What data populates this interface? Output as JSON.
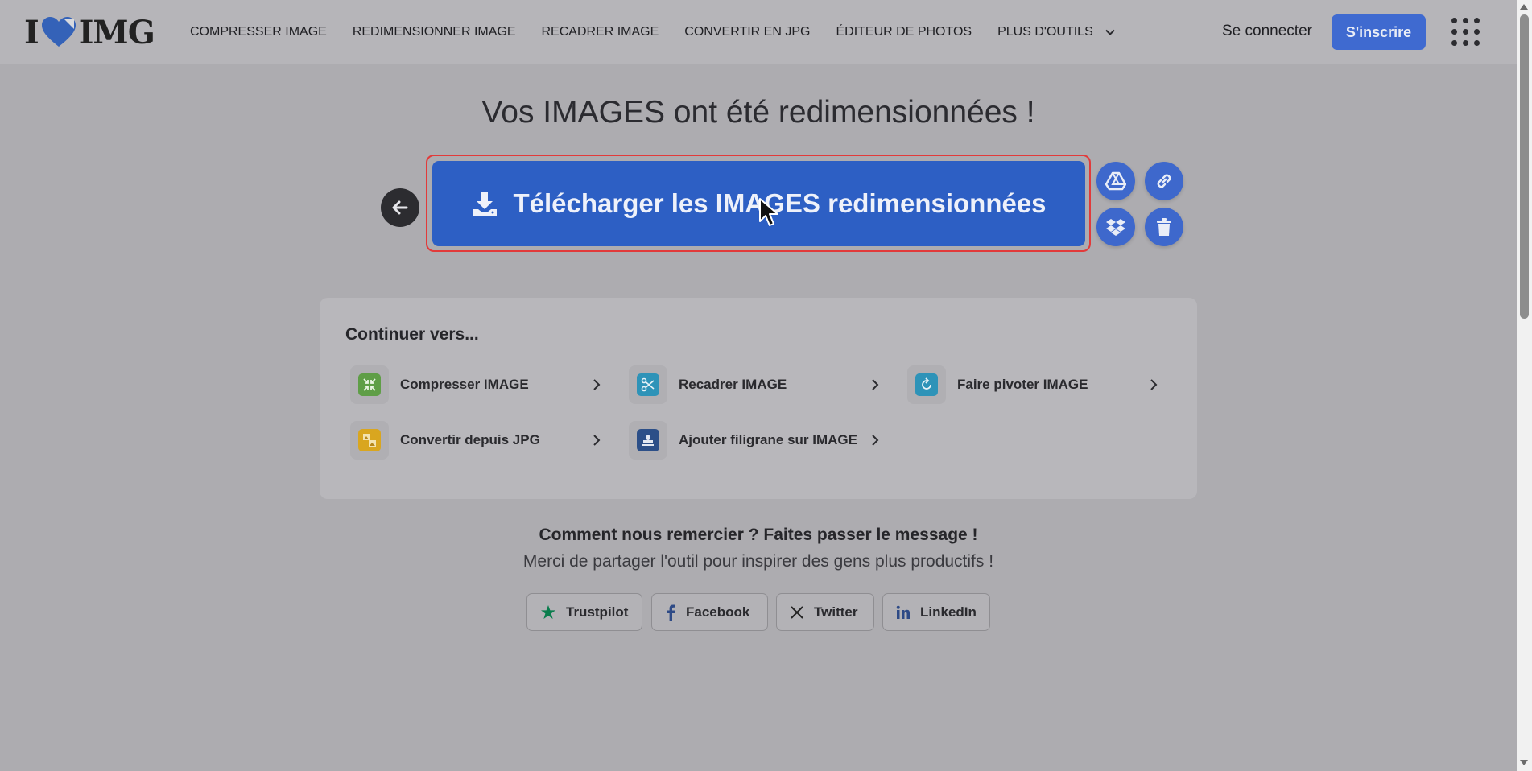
{
  "header": {
    "logo_text": "IMG",
    "logo_prefix": "I",
    "nav": [
      {
        "label": "COMPRESSER IMAGE"
      },
      {
        "label": "REDIMENSIONNER IMAGE"
      },
      {
        "label": "RECADRER IMAGE"
      },
      {
        "label": "CONVERTIR EN JPG"
      },
      {
        "label": "ÉDITEUR DE PHOTOS"
      },
      {
        "label": "PLUS D'OUTILS"
      }
    ],
    "login_label": "Se connecter",
    "signup_label": "S'inscrire"
  },
  "main": {
    "title": "Vos IMAGES ont été redimensionnées !",
    "download_label": "Télécharger les IMAGES redimensionnées"
  },
  "continue": {
    "title": "Continuer vers...",
    "tools": [
      {
        "label": "Compresser IMAGE",
        "icon": "compress-icon",
        "color": "#5f9e47"
      },
      {
        "label": "Recadrer IMAGE",
        "icon": "scissors-icon",
        "color": "#2e93b8"
      },
      {
        "label": "Faire pivoter IMAGE",
        "icon": "rotate-icon",
        "color": "#2e93b8"
      },
      {
        "label": "Convertir depuis JPG",
        "icon": "convert-icon",
        "color": "#d9a61f"
      },
      {
        "label": "Ajouter filigrane sur IMAGE",
        "icon": "stamp-icon",
        "color": "#2c4f88"
      }
    ]
  },
  "thanks": {
    "title": "Comment nous remercier ? Faites passer le message !",
    "subtitle": "Merci de partager l'outil pour inspirer des gens plus productifs !",
    "share": [
      {
        "label": "Trustpilot"
      },
      {
        "label": "Facebook"
      },
      {
        "label": "Twitter"
      },
      {
        "label": "LinkedIn"
      }
    ]
  },
  "colors": {
    "accent": "#3f6ad0",
    "download": "#2d5fc4",
    "highlight": "#e23a3a"
  }
}
